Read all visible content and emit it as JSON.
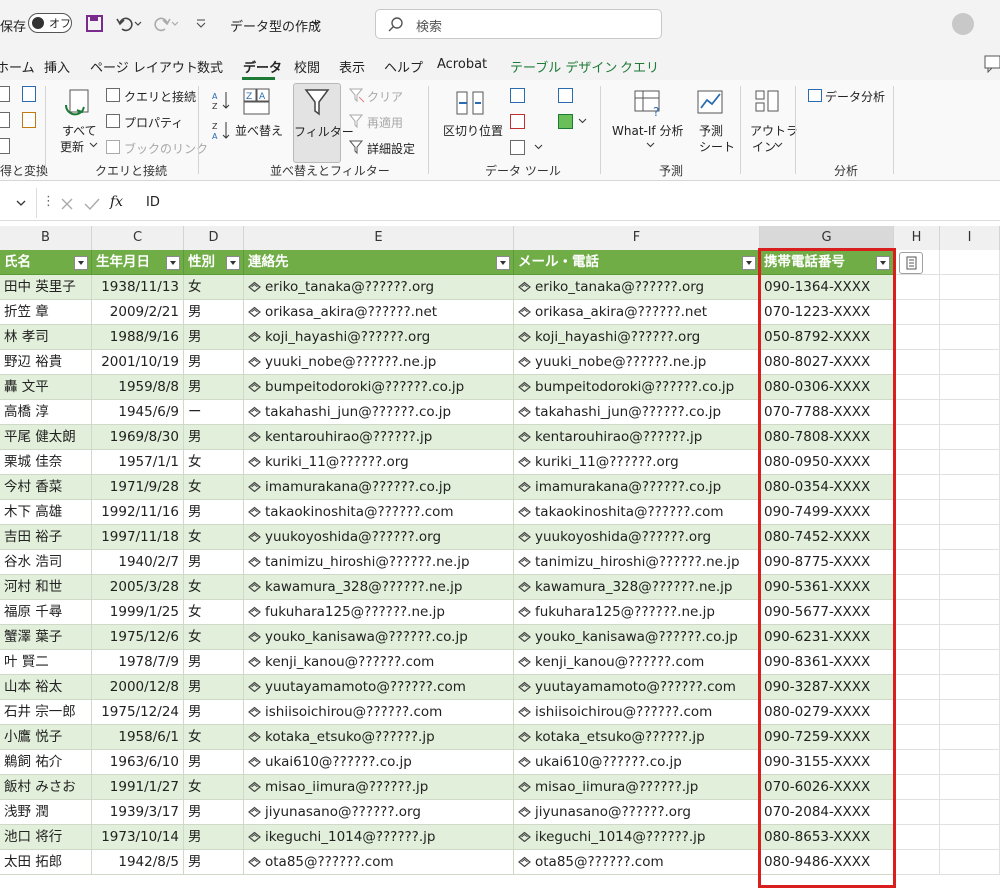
{
  "titlebar": {
    "autosave": "保存",
    "toggle": "オフ",
    "filename": "データ型の作成",
    "search_placeholder": "検索"
  },
  "tabs": [
    "ホーム",
    "挿入",
    "ページ レイアウト",
    "数式",
    "データ",
    "校閲",
    "表示",
    "ヘルプ",
    "Acrobat",
    "テーブル デザイン",
    "クエリ"
  ],
  "ribbon": {
    "get_transform_label": "得と変換",
    "refresh_all": "すべて",
    "refresh_all2": "更新",
    "queries_connections": "クエリと接続",
    "properties": "プロパティ",
    "book_links": "ブックのリンク",
    "group_queries": "クエリと接続",
    "sort": "並べ替え",
    "filter": "フィルター",
    "clear": "クリア",
    "reapply": "再適用",
    "advanced": "詳細設定",
    "group_sort_filter": "並べ替えとフィルター",
    "text_to_columns": "区切り位置",
    "group_data_tools": "データ ツール",
    "whatif": "What-If 分析",
    "forecast1": "予測",
    "forecast2": "シート",
    "group_forecast": "予測",
    "outline1": "アウトラ",
    "outline2": "イン",
    "data_analysis": "データ分析",
    "group_analysis": "分析"
  },
  "formula": {
    "fx": "fx",
    "value": "ID"
  },
  "columns": [
    "B",
    "C",
    "D",
    "E",
    "F",
    "G",
    "H",
    "I"
  ],
  "headers": [
    "氏名",
    "生年月日",
    "性別",
    "連絡先",
    "メール・電話",
    "携帯電話番号"
  ],
  "rows": [
    [
      "田中 英里子",
      "1938/11/13",
      "女",
      "eriko_tanaka@??????.org",
      "eriko_tanaka@??????.org",
      "090-1364-XXXX"
    ],
    [
      "折笠 章",
      "2009/2/21",
      "男",
      "orikasa_akira@??????.net",
      "orikasa_akira@??????.net",
      "070-1223-XXXX"
    ],
    [
      "林 孝司",
      "1988/9/16",
      "男",
      "koji_hayashi@??????.org",
      "koji_hayashi@??????.org",
      "050-8792-XXXX"
    ],
    [
      "野辺 裕貴",
      "2001/10/19",
      "男",
      "yuuki_nobe@??????.ne.jp",
      "yuuki_nobe@??????.ne.jp",
      "080-8027-XXXX"
    ],
    [
      "轟 文平",
      "1959/8/8",
      "男",
      "bumpeitodoroki@??????.co.jp",
      "bumpeitodoroki@??????.co.jp",
      "080-0306-XXXX"
    ],
    [
      "高橋 淳",
      "1945/6/9",
      "ー",
      "takahashi_jun@??????.co.jp",
      "takahashi_jun@??????.co.jp",
      "070-7788-XXXX"
    ],
    [
      "平尾 健太朗",
      "1969/8/30",
      "男",
      "kentarouhirao@??????.jp",
      "kentarouhirao@??????.jp",
      "080-7808-XXXX"
    ],
    [
      "栗城 佳奈",
      "1957/1/1",
      "女",
      "kuriki_11@??????.org",
      "kuriki_11@??????.org",
      "080-0950-XXXX"
    ],
    [
      "今村 香菜",
      "1971/9/28",
      "女",
      "imamurakana@??????.co.jp",
      "imamurakana@??????.co.jp",
      "080-0354-XXXX"
    ],
    [
      "木下 高雄",
      "1992/11/16",
      "男",
      "takaokinoshita@??????.com",
      "takaokinoshita@??????.com",
      "090-7499-XXXX"
    ],
    [
      "吉田 裕子",
      "1997/11/18",
      "女",
      "yuukoyoshida@??????.org",
      "yuukoyoshida@??????.org",
      "080-7452-XXXX"
    ],
    [
      "谷水 浩司",
      "1940/2/7",
      "男",
      "tanimizu_hiroshi@??????.ne.jp",
      "tanimizu_hiroshi@??????.ne.jp",
      "090-8775-XXXX"
    ],
    [
      "河村 和世",
      "2005/3/28",
      "女",
      "kawamura_328@??????.ne.jp",
      "kawamura_328@??????.ne.jp",
      "090-5361-XXXX"
    ],
    [
      "福原 千尋",
      "1999/1/25",
      "女",
      "fukuhara125@??????.ne.jp",
      "fukuhara125@??????.ne.jp",
      "090-5677-XXXX"
    ],
    [
      "蟹澤 葉子",
      "1975/12/6",
      "女",
      "youko_kanisawa@??????.co.jp",
      "youko_kanisawa@??????.co.jp",
      "090-6231-XXXX"
    ],
    [
      "叶 賢二",
      "1978/7/9",
      "男",
      "kenji_kanou@??????.com",
      "kenji_kanou@??????.com",
      "090-8361-XXXX"
    ],
    [
      "山本 裕太",
      "2000/12/8",
      "男",
      "yuutayamamoto@??????.com",
      "yuutayamamoto@??????.com",
      "090-3287-XXXX"
    ],
    [
      "石井 宗一郎",
      "1975/12/24",
      "男",
      "ishiisoichirou@??????.com",
      "ishiisoichirou@??????.com",
      "080-0279-XXXX"
    ],
    [
      "小鷹 悦子",
      "1958/6/1",
      "女",
      "kotaka_etsuko@??????.jp",
      "kotaka_etsuko@??????.jp",
      "090-7259-XXXX"
    ],
    [
      "鵜飼 祐介",
      "1963/6/10",
      "男",
      "ukai610@??????.co.jp",
      "ukai610@??????.co.jp",
      "090-3155-XXXX"
    ],
    [
      "飯村 みさお",
      "1991/1/27",
      "女",
      "misao_iimura@??????.jp",
      "misao_iimura@??????.jp",
      "070-6026-XXXX"
    ],
    [
      "浅野 潤",
      "1939/3/17",
      "男",
      "jiyunasano@??????.org",
      "jiyunasano@??????.org",
      "070-2084-XXXX"
    ],
    [
      "池口 将行",
      "1973/10/14",
      "男",
      "ikeguchi_1014@??????.jp",
      "ikeguchi_1014@??????.jp",
      "080-8653-XXXX"
    ],
    [
      "太田 拓郎",
      "1942/8/5",
      "男",
      "ota85@??????.com",
      "ota85@??????.com",
      "080-9486-XXXX"
    ]
  ],
  "colors": {
    "header_green": "#70ad47",
    "band_green": "#e2efda",
    "highlight_red": "#d91e1e",
    "tab_green": "#1e7a37"
  }
}
